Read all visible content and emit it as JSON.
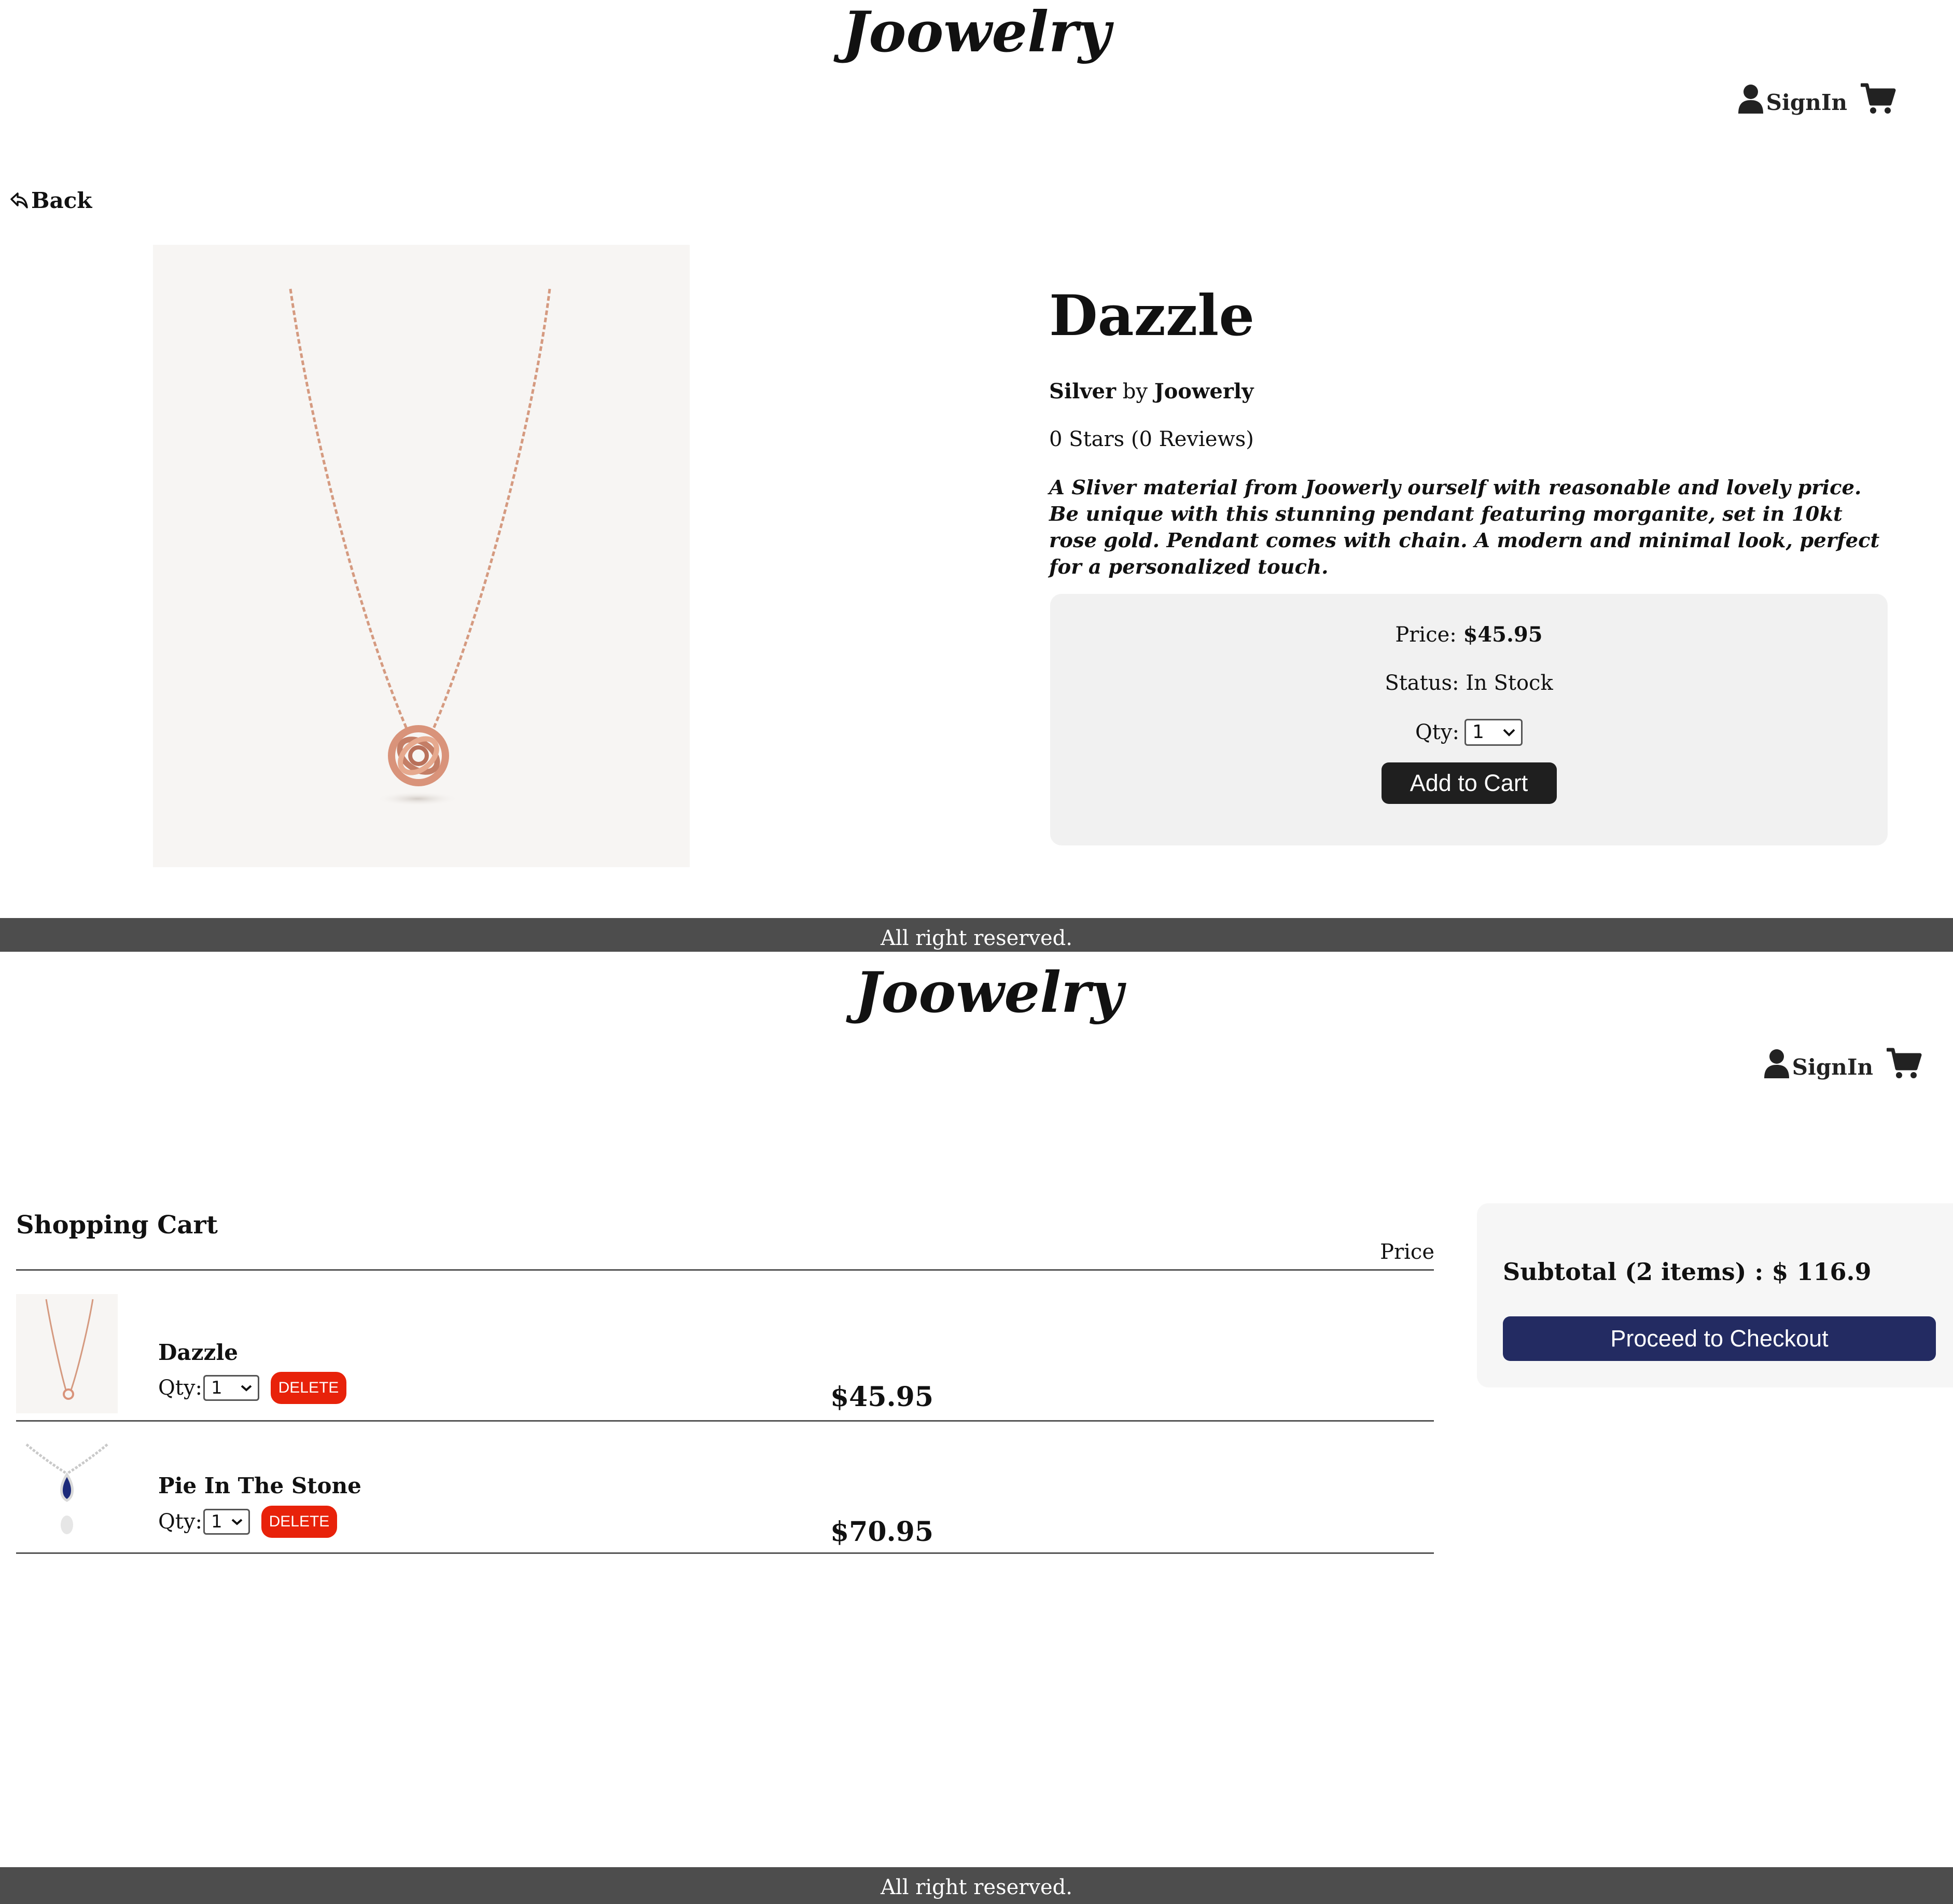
{
  "product_page": {
    "header": {
      "brand": "Joowelry",
      "signin_label": "SignIn",
      "signin_icon": "user-icon",
      "cart_icon": "cart-icon"
    },
    "back": {
      "label": "Back",
      "icon": "back-arrow-icon"
    },
    "product": {
      "name": "Dazzle",
      "material": "Silver",
      "brand_connector": "by",
      "brand": "Joowerly",
      "rating": "0 Stars (0 Reviews)",
      "description": "A Sliver material from Joowerly ourself with reasonable and lovely price. Be unique with this stunning pendant featuring morganite, set in 10kt rose gold. Pendant comes with chain. A modern and minimal look, perfect for a personalized touch.",
      "image": "rose-gold-knot-necklace"
    },
    "buy_box": {
      "price_label": "Price:",
      "price": "$45.95",
      "status_label": "Status:",
      "status": "In Stock",
      "qty_label": "Qty:",
      "qty_value": "1",
      "add_to_cart_label": "Add to Cart"
    },
    "footer": "All right reserved."
  },
  "cart_page": {
    "header": {
      "brand": "Joowelry",
      "signin_label": "SignIn",
      "signin_icon": "user-icon",
      "cart_icon": "cart-icon"
    },
    "heading": "Shopping Cart",
    "price_column_label": "Price",
    "items": [
      {
        "name": "Dazzle",
        "qty_label": "Qty:",
        "qty_value": "1",
        "delete_label": "DELETE",
        "price": "$45.95",
        "image": "rose-gold-knot-necklace"
      },
      {
        "name": "Pie In The Stone",
        "qty_label": "Qty:",
        "qty_value": "1",
        "delete_label": "DELETE",
        "price": "$70.95",
        "image": "sapphire-pendant-necklace"
      }
    ],
    "summary": {
      "subtotal": "Subtotal (2 items) : $ 116.9",
      "checkout_label": "Proceed to Checkout"
    },
    "footer": "All right reserved."
  },
  "colors": {
    "footer_bg": "#4d4d4d",
    "add_to_cart_bg": "#1f1f1f",
    "delete_bg": "#e8220a",
    "checkout_bg": "#232b62",
    "buy_box_bg": "#f1f1f1",
    "summary_bg": "#f6f6f6",
    "rose_gold": "#d59a80"
  }
}
